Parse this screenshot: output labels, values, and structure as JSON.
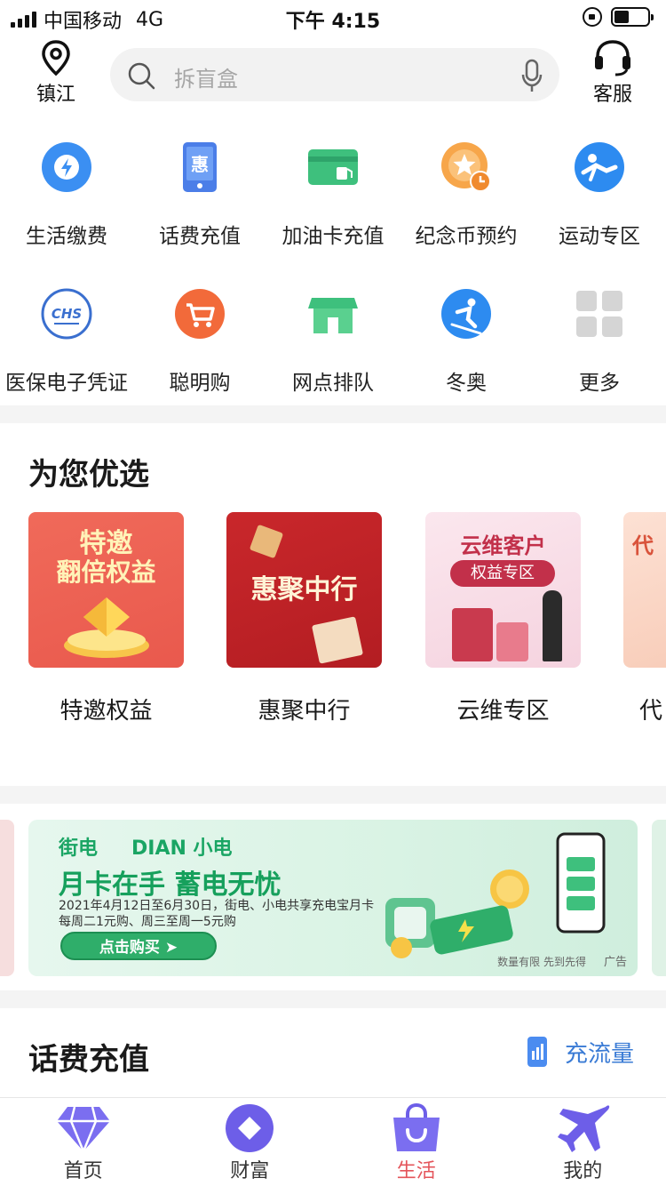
{
  "status_bar": {
    "carrier": "中国移动",
    "network": "4G",
    "time": "下午 4:15"
  },
  "header": {
    "location": "镇江",
    "search_placeholder": "拆盲盒",
    "customer_service": "客服"
  },
  "services": [
    {
      "label": "生活缴费",
      "icon": "bolt-icon"
    },
    {
      "label": "话费充值",
      "icon": "phone-bill-icon"
    },
    {
      "label": "加油卡充值",
      "icon": "fuel-card-icon"
    },
    {
      "label": "纪念币预约",
      "icon": "coin-icon"
    },
    {
      "label": "运动专区",
      "icon": "sport-icon"
    },
    {
      "label": "医保电子凭证",
      "icon": "chs-icon",
      "badge": "CHS"
    },
    {
      "label": "聪明购",
      "icon": "cart-icon"
    },
    {
      "label": "网点排队",
      "icon": "store-icon"
    },
    {
      "label": "冬奥",
      "icon": "ski-icon"
    },
    {
      "label": "更多",
      "icon": "grid-more-icon"
    }
  ],
  "recommend": {
    "title": "为您优选",
    "cards": [
      {
        "caption": "特邀权益",
        "art_text": [
          "特邀",
          "翻倍权益"
        ]
      },
      {
        "caption": "惠聚中行",
        "art_text": [
          "惠聚中行"
        ]
      },
      {
        "caption": "云维专区",
        "art_text": [
          "云维客户",
          "权益专区"
        ]
      },
      {
        "caption": "代",
        "art_text": [
          "代"
        ]
      }
    ]
  },
  "ad": {
    "brand_left": "街电",
    "brand_right": "DIAN 小电",
    "headline": "月卡在手 蓄电无忧",
    "sub1": "2021年4月12日至6月30日，街电、小电共享充电宝月卡",
    "sub2": "每周二1元购、周三至周一5元购",
    "button": "点击购买 ➤",
    "note": "数量有限 先到先得",
    "tag": "广告"
  },
  "topup": {
    "title": "话费充值",
    "flow_label": "充流量"
  },
  "tabs": [
    {
      "label": "首页",
      "icon": "diamond-icon"
    },
    {
      "label": "财富",
      "icon": "wealth-icon"
    },
    {
      "label": "生活",
      "icon": "shopping-bag-icon",
      "active": true
    },
    {
      "label": "我的",
      "icon": "plane-icon"
    }
  ],
  "colors": {
    "active_tab": "#e4545a",
    "accent_blue": "#3a7bd5",
    "ad_green": "#16a05c",
    "separator": "#f4f4f4"
  }
}
